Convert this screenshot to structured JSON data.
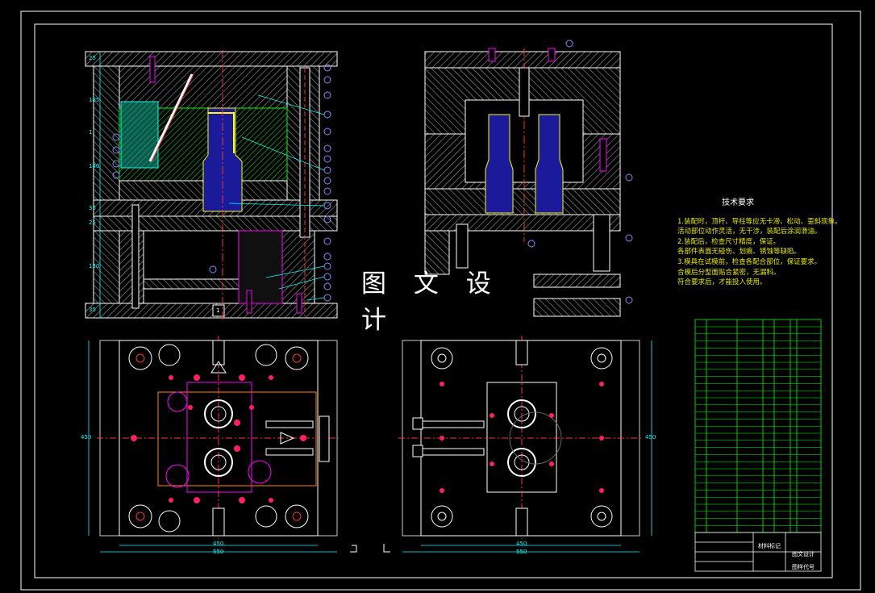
{
  "watermark": "图 文 设 计",
  "tech_requirements": {
    "heading": "技术要求",
    "lines": [
      "1.装配时，顶杆、导柱等应无卡滞、松动、歪斜现象。",
      "活动部位动作灵活，无干涉，装配后涂润滑油。",
      "2.装配后，检查尺寸精度，保证。",
      "各部件表面无碰伤、划痕、锈蚀等缺陷。",
      "3.模具在试模前，检查各配合部位，保证要求。",
      "合模后分型面贴合紧密，无漏料。",
      "符合要求后，才能投入使用。"
    ]
  },
  "title_block": {
    "material_label": "材料标记",
    "company_label": "图文设计",
    "code_label": "图样代号"
  },
  "dims": {
    "plan_left_width": "450",
    "plan_left_outer": "550",
    "plan_left_height": "450",
    "plan_right_width": "450",
    "plan_right_outer": "550",
    "plan_right_height": "450",
    "side_dims": [
      "25",
      "185",
      "1",
      "140",
      "35",
      "25",
      "120",
      "35"
    ],
    "marker_bottom": "1"
  },
  "colors": {
    "background": "#000000",
    "hatch": "#c8c8c8",
    "outline": "#ffffff",
    "green": "#00ff00",
    "cyan": "#00ffff",
    "yellow": "#ffff00",
    "blue_part": "#1a1a9a",
    "magenta": "#ff00ff",
    "red": "#ff2020",
    "teal_fill": "#0a6b5a"
  }
}
